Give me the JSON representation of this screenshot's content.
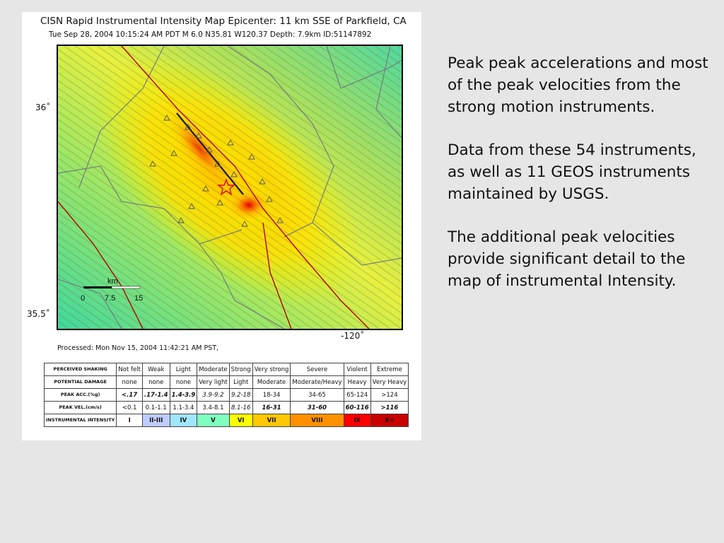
{
  "map": {
    "title": "CISN Rapid Instrumental Intensity Map Epicenter:  11 km SSE of Parkfield, CA",
    "subtitle": "Tue Sep 28, 2004 10:15:24 AM PDT   M 6.0   N35.81 W120.37   Depth: 7.9km   ID:51147892",
    "lat_top": "36˚",
    "lat_bottom": "35.5˚",
    "lon": "-120˚",
    "scale": {
      "unit": "km",
      "ticks": [
        "0",
        "7.5",
        "15"
      ]
    },
    "processed": "Processed: Mon Nov 15, 2004 11:42:21 AM PST,"
  },
  "legend": {
    "rows": [
      {
        "label": "PERCEIVED SHAKING",
        "values": [
          "Not felt",
          "Weak",
          "Light",
          "Moderate",
          "Strong",
          "Very strong",
          "Severe",
          "Violent",
          "Extreme"
        ]
      },
      {
        "label": "POTENTIAL DAMAGE",
        "values": [
          "none",
          "none",
          "none",
          "Very light",
          "Light",
          "Moderate",
          "Moderate/Heavy",
          "Heavy",
          "Very Heavy"
        ]
      },
      {
        "label": "PEAK ACC.(%g)",
        "values": [
          "<.17",
          ".17-1.4",
          "1.4-3.9",
          "3.9-9.2",
          "9.2-18",
          "18-34",
          "34-65",
          "65-124",
          ">124"
        ]
      },
      {
        "label": "PEAK VEL.(cm/s)",
        "values": [
          "<0.1",
          "0.1-1.1",
          "1.1-3.4",
          "3.4-8.1",
          "8.1-16",
          "16-31",
          "31-60",
          "60-116",
          ">116"
        ]
      },
      {
        "label": "INSTRUMENTAL INTENSITY",
        "values": [
          "I",
          "II-III",
          "IV",
          "V",
          "VI",
          "VII",
          "VIII",
          "IX",
          "X+"
        ]
      }
    ],
    "intensity_colors": [
      "#ffffff",
      "#bfccff",
      "#a0e6ff",
      "#80ffc0",
      "#ffff00",
      "#ffc800",
      "#ff9100",
      "#ff0000",
      "#c80000"
    ]
  },
  "notes": {
    "p1": "Peak peak accelerations and most of the peak velocities from the strong motion instruments.",
    "p2": "Data from these 54 instruments, as well as 11 GEOS instruments maintained by USGS.",
    "p3": "The additional peak velocities provide significant detail to the map of instrumental Intensity."
  }
}
